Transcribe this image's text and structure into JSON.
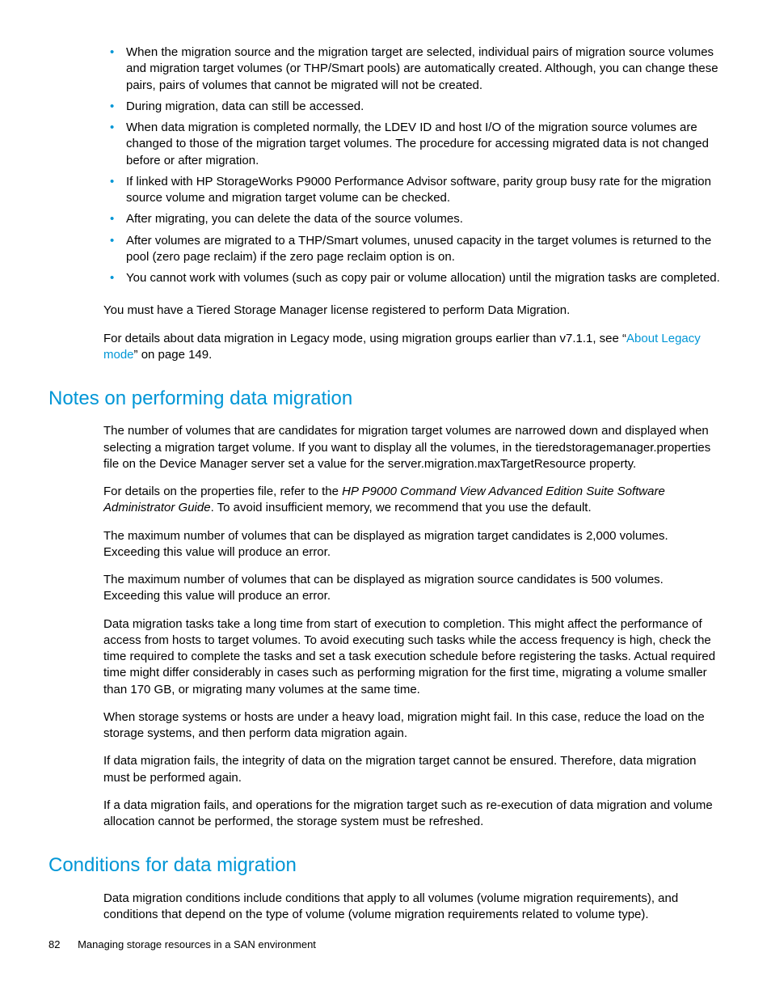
{
  "bullets_top": [
    "When the migration source and the migration target are selected, individual pairs of migration source volumes and migration target volumes (or THP/Smart pools) are automatically created. Although, you can change these pairs, pairs of volumes that cannot be migrated will not be created.",
    "During migration, data can still be accessed.",
    "When data migration is completed normally, the LDEV ID and host I/O of the migration source volumes are changed to those of the migration target volumes. The procedure for accessing migrated data is not changed before or after migration.",
    "If linked with HP StorageWorks P9000 Performance Advisor software, parity group busy rate for the migration source volume and migration target volume can be checked.",
    "After migrating, you can delete the data of the source volumes.",
    "After volumes are migrated to a THP/Smart volumes, unused capacity in the target volumes is returned to the pool (zero page reclaim) if the zero page reclaim option is on.",
    "You cannot work with volumes (such as copy pair or volume allocation) until the migration tasks are completed."
  ],
  "para_after_bullets_1": "You must have a Tiered Storage Manager license registered to perform Data Migration.",
  "para_after_bullets_2_pre": "For details about data migration in Legacy mode, using migration groups earlier than v7.1.1, see “",
  "para_after_bullets_2_link": "About Legacy mode",
  "para_after_bullets_2_post": "” on page 149.",
  "heading_notes": "Notes on performing data migration",
  "notes_p1": "The number of volumes that are candidates for migration target volumes are narrowed down and displayed when selecting a migration target volume. If you want to display all the volumes, in the tieredstoragemanager.properties file on the Device Manager server set a value for the server.migration.maxTargetResource property.",
  "notes_p2_pre": "For details on the properties file, refer to the ",
  "notes_p2_italic": "HP P9000 Command View Advanced Edition Suite Software Administrator Guide",
  "notes_p2_post": ". To avoid insufficient memory, we recommend that you use the default.",
  "notes_p3": "The maximum number of volumes that can be displayed as migration target candidates is 2,000 volumes. Exceeding this value will produce an error.",
  "notes_p4": "The maximum number of volumes that can be displayed as migration source candidates is 500 volumes. Exceeding this value will produce an error.",
  "notes_p5": "Data migration tasks take a long time from start of execution to completion. This might affect the performance of access from hosts to target volumes. To avoid executing such tasks while the access frequency is high, check the time required to complete the tasks and set a task execution schedule before registering the tasks. Actual required time might differ considerably in cases such as performing migration for the first time, migrating a volume smaller than 170 GB, or migrating many volumes at the same time.",
  "notes_p6": "When storage systems or hosts are under a heavy load, migration might fail. In this case, reduce the load on the storage systems, and then perform data migration again.",
  "notes_p7": "If data migration fails, the integrity of data on the migration target cannot be ensured. Therefore, data migration must be performed again.",
  "notes_p8": "If a data migration fails, and operations for the migration target such as re-execution of data migration and volume allocation cannot be performed, the storage system must be refreshed.",
  "heading_conditions": "Conditions for data migration",
  "conditions_p1": "Data migration conditions include conditions that apply to all volumes (volume migration requirements), and conditions that depend on the type of volume (volume migration requirements related to volume type).",
  "footer_page": "82",
  "footer_text": "Managing storage resources in a SAN environment"
}
